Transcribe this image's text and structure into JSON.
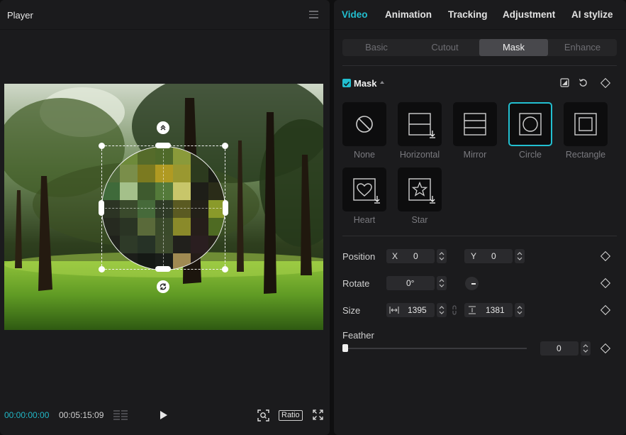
{
  "player": {
    "title": "Player",
    "menu_icon": "hamburger-menu-icon",
    "current_time": "00:00:00:00",
    "total_time": "00:05:15:09",
    "ratio_label": "Ratio",
    "icons": [
      "timeline-bars-icon",
      "play-icon",
      "fit-screen-icon",
      "fullscreen-icon"
    ]
  },
  "inspector": {
    "tabs": [
      {
        "label": "Video",
        "active": true
      },
      {
        "label": "Animation"
      },
      {
        "label": "Tracking"
      },
      {
        "label": "Adjustment"
      },
      {
        "label": "AI stylize"
      }
    ],
    "subtabs": [
      {
        "label": "Basic"
      },
      {
        "label": "Cutout"
      },
      {
        "label": "Mask",
        "active": true
      },
      {
        "label": "Enhance"
      }
    ],
    "mask": {
      "enabled": true,
      "title": "Mask",
      "shapes": [
        {
          "label": "None",
          "icon": "none-icon"
        },
        {
          "label": "Horizontal",
          "icon": "horizontal-mask-icon"
        },
        {
          "label": "Mirror",
          "icon": "mirror-mask-icon"
        },
        {
          "label": "Circle",
          "icon": "circle-mask-icon",
          "selected": true
        },
        {
          "label": "Rectangle",
          "icon": "rectangle-mask-icon"
        },
        {
          "label": "Heart",
          "icon": "heart-mask-icon"
        },
        {
          "label": "Star",
          "icon": "star-mask-icon"
        }
      ]
    },
    "position": {
      "label": "Position",
      "x_label": "X",
      "x": "0",
      "y_label": "Y",
      "y": "0"
    },
    "rotate": {
      "label": "Rotate",
      "value": "0°"
    },
    "size": {
      "label": "Size",
      "width": "1395",
      "height": "1381"
    },
    "feather": {
      "label": "Feather",
      "value": "0",
      "fraction": 0
    }
  },
  "colors": {
    "accent": "#22bfd0",
    "panel": "#1b1b1d",
    "background": "#0f0f10"
  }
}
